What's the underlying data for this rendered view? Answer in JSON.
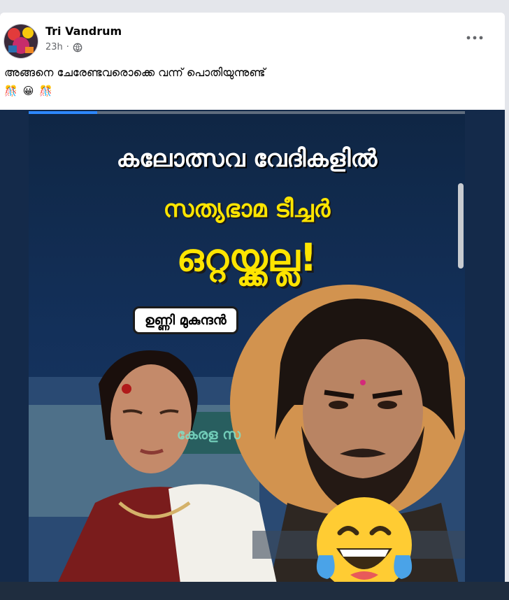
{
  "post": {
    "author": "Tri Vandrum",
    "time": "23h",
    "text": "അങ്ങനെ ചേരേണ്ടവരൊക്കെ വന്ന് പൊതിയുന്നുണ്ട്",
    "emojis": [
      "🎊",
      "😀",
      "🎊"
    ],
    "icons": {
      "privacy": "globe-icon",
      "menu": "more-options-icon"
    }
  },
  "poster": {
    "line1": "കലോത്സവ വേദികളിൽ",
    "line2": "സത്യഭാമ ടീച്ചർ",
    "line3": "ഒറ്റയ്ക്കല്ല!",
    "name_tag": "ഉണ്ണി മുകുന്ദൻ",
    "background_sign": "കേരള സ",
    "sticker": "laughing-tears-emoji"
  },
  "colors": {
    "headline_white": "#ffffff",
    "headline_yellow": "#ffe500",
    "poster_bg": "#13305a",
    "feed_bg": "#e4e6eb"
  }
}
